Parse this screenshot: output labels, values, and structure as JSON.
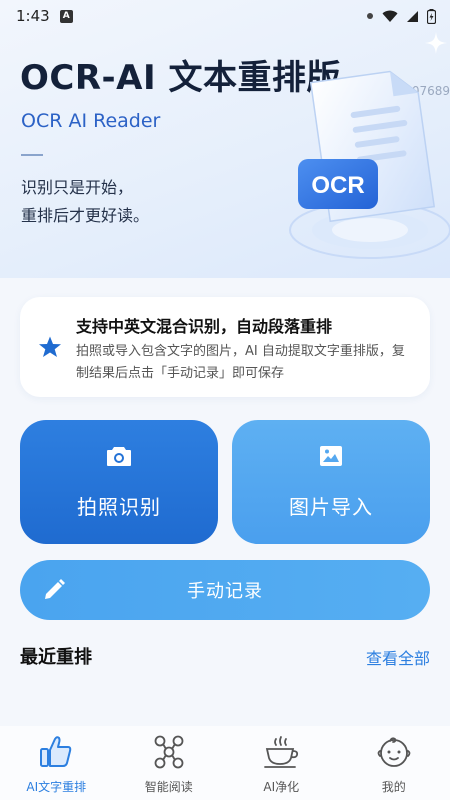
{
  "status_bar": {
    "time": "1:43",
    "app_indicator": "A"
  },
  "hero": {
    "title": "OCR-AI 文本重排版",
    "subtitle": "OCR AI Reader",
    "line1": "识别只是开始，",
    "line2": "重排后才更好读。",
    "id_text": "ID:b07689",
    "badge": "OCR"
  },
  "info_card": {
    "title": "支持中英文混合识别，自动段落重排",
    "description": "拍照或导入包含文字的图片，AI 自动提取文字重排版，复制结果后点击「手动记录」即可保存"
  },
  "actions": {
    "camera_label": "拍照识别",
    "import_label": "图片导入",
    "manual_label": "手动记录"
  },
  "recent": {
    "title": "最近重排",
    "view_all": "查看全部"
  },
  "tabs": [
    {
      "label": "AI文字重排",
      "icon": "thumbs-up-icon",
      "active": true
    },
    {
      "label": "智能阅读",
      "icon": "molecule-icon",
      "active": false
    },
    {
      "label": "AI净化",
      "icon": "cup-icon",
      "active": false
    },
    {
      "label": "我的",
      "icon": "baby-face-icon",
      "active": false
    }
  ],
  "colors": {
    "primary": "#1f6bd0",
    "secondary": "#4a9fee",
    "accent_text": "#2c7fe0"
  }
}
